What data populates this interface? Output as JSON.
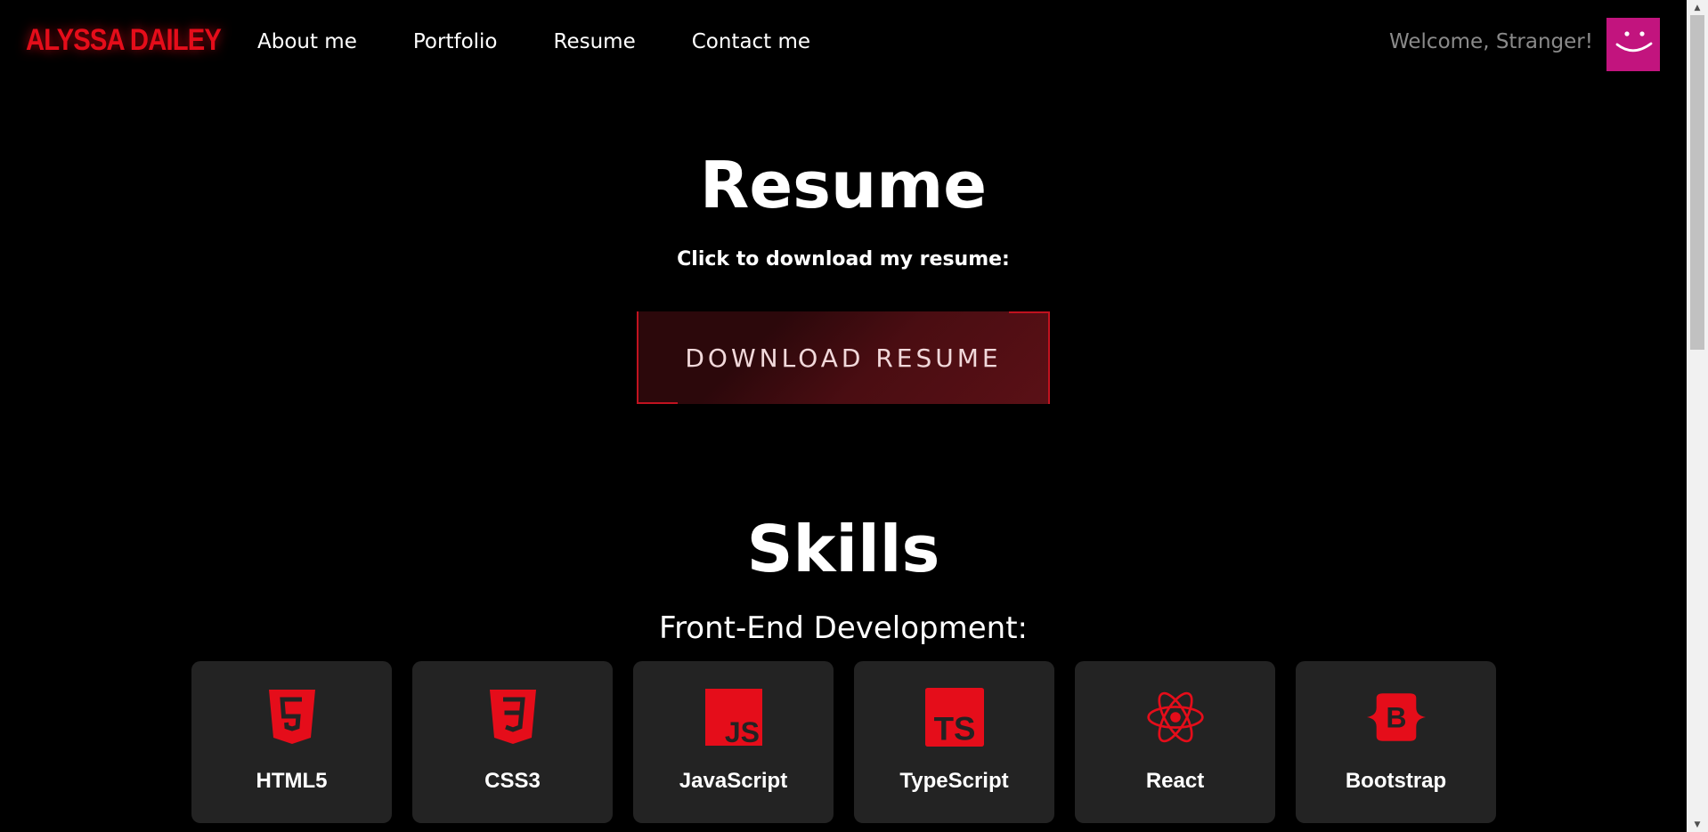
{
  "navbar": {
    "brand": "ALYSSA DAILEY",
    "links": [
      "About me",
      "Portfolio",
      "Resume",
      "Contact me"
    ],
    "welcome": "Welcome, Stranger!",
    "avatar_icon": "smiley-face-icon"
  },
  "resume": {
    "title": "Resume",
    "subtitle": "Click to download my resume:",
    "button_label": "DOWNLOAD RESUME"
  },
  "skills": {
    "title": "Skills",
    "subtitle": "Front-End Development:",
    "items": [
      {
        "label": "HTML5",
        "icon": "html5-icon"
      },
      {
        "label": "CSS3",
        "icon": "css3-icon"
      },
      {
        "label": "JavaScript",
        "icon": "javascript-icon"
      },
      {
        "label": "TypeScript",
        "icon": "typescript-icon"
      },
      {
        "label": "React",
        "icon": "react-icon"
      },
      {
        "label": "Bootstrap",
        "icon": "bootstrap-icon"
      }
    ]
  },
  "colors": {
    "accent": "#e50d1a",
    "avatar": "#c2147e",
    "card": "#232323",
    "background": "#000000"
  }
}
